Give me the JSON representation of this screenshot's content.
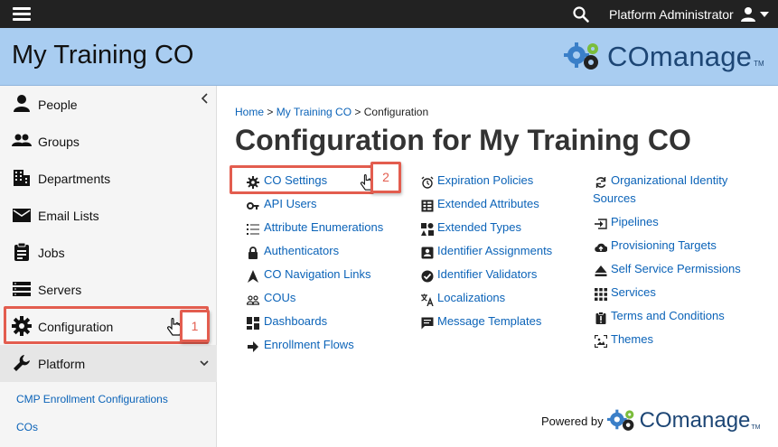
{
  "topbar": {
    "user_name": "Platform Administrator"
  },
  "banner": {
    "co_name": "My Training CO",
    "logo_text": "COmanage",
    "logo_tm": "TM"
  },
  "sidebar": {
    "items": [
      {
        "label": "People",
        "icon": "person-icon"
      },
      {
        "label": "Groups",
        "icon": "groups-icon"
      },
      {
        "label": "Departments",
        "icon": "building-icon"
      },
      {
        "label": "Email Lists",
        "icon": "envelope-icon"
      },
      {
        "label": "Jobs",
        "icon": "clipboard-icon"
      },
      {
        "label": "Servers",
        "icon": "servers-icon"
      },
      {
        "label": "Configuration",
        "icon": "gear-icon"
      },
      {
        "label": "Platform",
        "icon": "wrench-icon"
      }
    ],
    "sub_links": [
      "CMP Enrollment Configurations",
      "COs"
    ]
  },
  "badges": [
    "1",
    "2"
  ],
  "breadcrumb": {
    "home": "Home",
    "sep1": " > ",
    "co": "My Training CO",
    "sep2": " > ",
    "current": "Configuration"
  },
  "page_title": "Configuration for My Training CO",
  "links": {
    "col1": [
      "CO Settings",
      "API Users",
      "Attribute Enumerations",
      "Authenticators",
      "CO Navigation Links",
      "COUs",
      "Dashboards",
      "Enrollment Flows"
    ],
    "col2": [
      "Expiration Policies",
      "Extended Attributes",
      "Extended Types",
      "Identifier Assignments",
      "Identifier Validators",
      "Localizations",
      "Message Templates"
    ],
    "col3": [
      "Organizational Identity Sources",
      "Pipelines",
      "Provisioning Targets",
      "Self Service Permissions",
      "Services",
      "Terms and Conditions",
      "Themes"
    ]
  },
  "footer": {
    "powered_by": "Powered by",
    "logo_text": "COmanage",
    "logo_tm": "TM"
  },
  "colors": {
    "topbar": "#222222",
    "banner": "#a9cdf1",
    "link": "#0b63b8",
    "highlight": "#e35d4f"
  }
}
